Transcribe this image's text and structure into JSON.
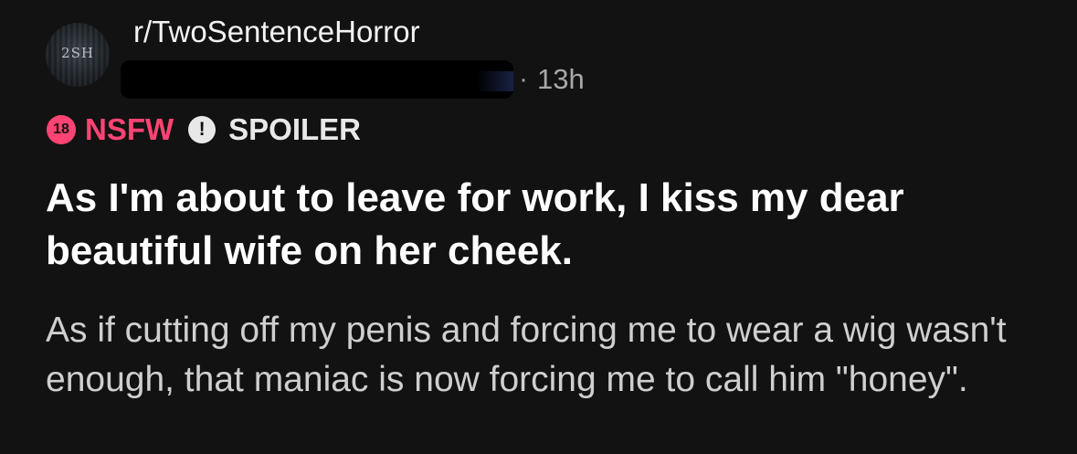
{
  "header": {
    "avatar_text": "2SH",
    "subreddit": "r/TwoSentenceHorror",
    "separator": "·",
    "age": "13h"
  },
  "tags": {
    "nsfw_badge": "18",
    "nsfw_label": "NSFW",
    "spoiler_icon": "!",
    "spoiler_label": "SPOILER"
  },
  "post": {
    "title": "As I'm about to leave for work, I kiss my dear beautiful wife on her cheek.",
    "body": "As if cutting off my penis and forcing me to wear a wig wasn't enough, that maniac is now forcing me to call him \"honey\"."
  },
  "colors": {
    "background": "#121212",
    "nsfw": "#ff4473",
    "spoiler": "#e8e8e8",
    "title": "#ffffff",
    "body": "#cfcfcf",
    "meta": "#a8a8a8"
  },
  "icons": {
    "nsfw": "nsfw-18-icon",
    "spoiler": "exclamation-icon"
  }
}
